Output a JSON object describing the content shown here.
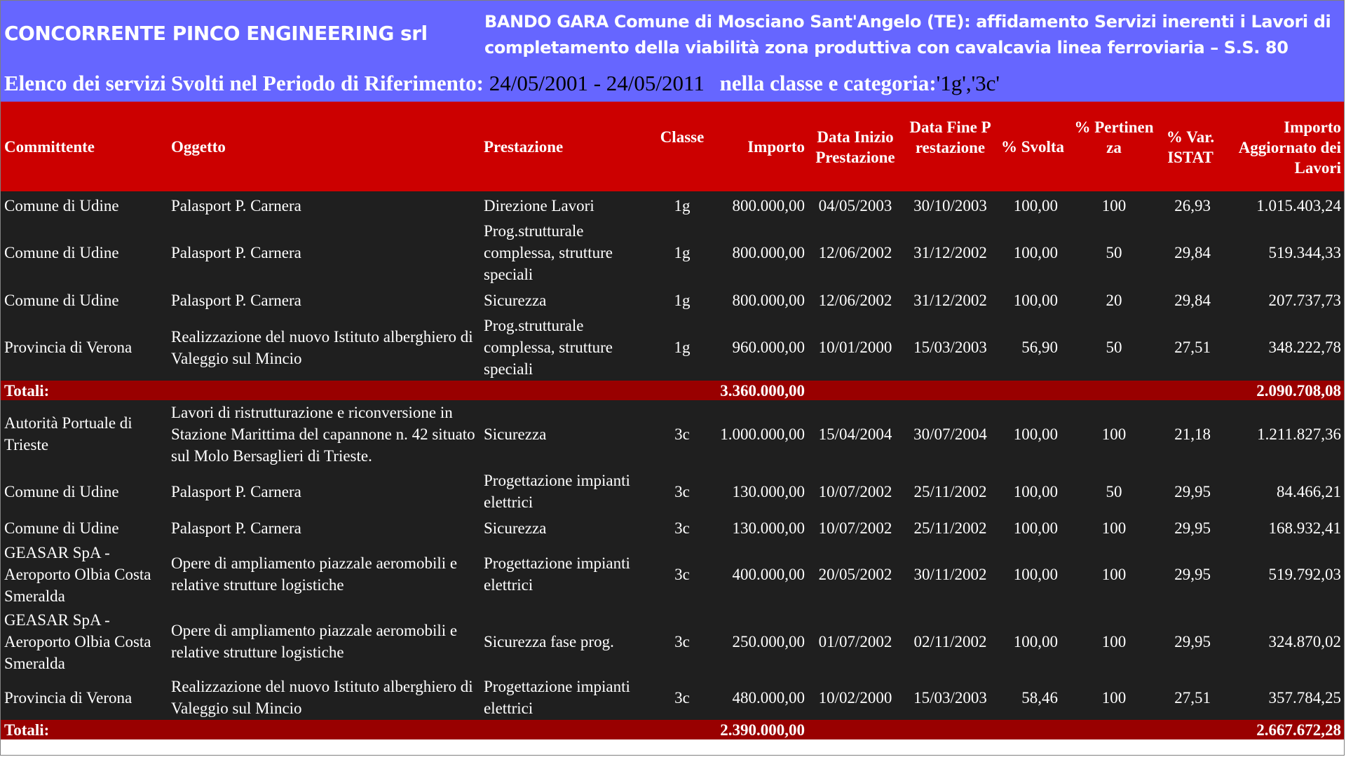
{
  "header": {
    "concorrente": "CONCORRENTE PINCO ENGINEERING srl",
    "bando": "BANDO GARA Comune di Mosciano Sant'Angelo (TE): affidamento Servizi inerenti i Lavori di completamento della viabilità zona produttiva con cavalcavia linea ferroviaria – S.S. 80",
    "elenco": "Elenco dei servizi",
    "svolti": "Svolti nel Periodo di Riferimento:",
    "period": "24/05/2001 - 24/05/2011",
    "classe_label": "nella classe e categoria:",
    "categoria": "'1g','3c'"
  },
  "columns": {
    "committente": "Committente",
    "oggetto": "Oggetto",
    "prestazione": "Prestazione",
    "classe": "Classe",
    "importo": "Importo",
    "data_inizio": "Data Inizio Prestazione",
    "data_fine": "Data Fine Prestazione",
    "svolta": "% Svolta",
    "pertinenza": "% Pertinenza",
    "var_istat": "% Var. ISTAT",
    "importo_agg": "Importo Aggiornato dei Lavori"
  },
  "rows": [
    {
      "type": "data",
      "committente": "Comune di Udine",
      "oggetto": "Palasport P. Carnera",
      "prestazione": "Direzione Lavori",
      "classe": "1g",
      "importo": "800.000,00",
      "inizio": "04/05/2003",
      "fine": "30/10/2003",
      "svolta": "100,00",
      "pertinenza": "100",
      "istat": "26,93",
      "agg": "1.015.403,24"
    },
    {
      "type": "data",
      "committente": "Comune di Udine",
      "oggetto": "Palasport P. Carnera",
      "prestazione": "Prog.strutturale complessa, strutture speciali",
      "classe": "1g",
      "importo": "800.000,00",
      "inizio": "12/06/2002",
      "fine": "31/12/2002",
      "svolta": "100,00",
      "pertinenza": "50",
      "istat": "29,84",
      "agg": "519.344,33"
    },
    {
      "type": "data",
      "committente": "Comune di Udine",
      "oggetto": "Palasport P. Carnera",
      "prestazione": "Sicurezza",
      "classe": "1g",
      "importo": "800.000,00",
      "inizio": "12/06/2002",
      "fine": "31/12/2002",
      "svolta": "100,00",
      "pertinenza": "20",
      "istat": "29,84",
      "agg": "207.737,73"
    },
    {
      "type": "data",
      "committente": "Provincia di Verona",
      "oggetto": "Realizzazione del nuovo Istituto alberghiero di Valeggio sul Mincio",
      "prestazione": "Prog.strutturale complessa, strutture speciali",
      "classe": "1g",
      "importo": "960.000,00",
      "inizio": "10/01/2000",
      "fine": "15/03/2003",
      "svolta": "56,90",
      "pertinenza": "50",
      "istat": "27,51",
      "agg": "348.222,78"
    },
    {
      "type": "total",
      "label": "Totali:",
      "importo": "3.360.000,00",
      "agg": "2.090.708,08"
    },
    {
      "type": "data",
      "committente": "Autorità Portuale di Trieste",
      "oggetto": "Lavori di ristrutturazione e riconversione in Stazione Marittima del capannone n. 42 situato sul Molo Bersaglieri di Trieste.",
      "prestazione": "Sicurezza",
      "classe": "3c",
      "importo": "1.000.000,00",
      "inizio": "15/04/2004",
      "fine": "30/07/2004",
      "svolta": "100,00",
      "pertinenza": "100",
      "istat": "21,18",
      "agg": "1.211.827,36"
    },
    {
      "type": "data",
      "committente": "Comune di Udine",
      "oggetto": "Palasport P. Carnera",
      "prestazione": "Progettazione impianti elettrici",
      "classe": "3c",
      "importo": "130.000,00",
      "inizio": "10/07/2002",
      "fine": "25/11/2002",
      "svolta": "100,00",
      "pertinenza": "50",
      "istat": "29,95",
      "agg": "84.466,21"
    },
    {
      "type": "data",
      "committente": "Comune di Udine",
      "oggetto": "Palasport P. Carnera",
      "prestazione": "Sicurezza",
      "classe": "3c",
      "importo": "130.000,00",
      "inizio": "10/07/2002",
      "fine": "25/11/2002",
      "svolta": "100,00",
      "pertinenza": "100",
      "istat": "29,95",
      "agg": "168.932,41"
    },
    {
      "type": "data",
      "committente": "GEASAR SpA -Aeroporto Olbia Costa Smeralda",
      "oggetto": "Opere di ampliamento piazzale aeromobili e relative strutture logistiche",
      "prestazione": "Progettazione impianti elettrici",
      "classe": "3c",
      "importo": "400.000,00",
      "inizio": "20/05/2002",
      "fine": "30/11/2002",
      "svolta": "100,00",
      "pertinenza": "100",
      "istat": "29,95",
      "agg": "519.792,03"
    },
    {
      "type": "data",
      "committente": "GEASAR SpA -Aeroporto Olbia Costa Smeralda",
      "oggetto": "Opere di ampliamento piazzale aeromobili e relative strutture logistiche",
      "prestazione": "Sicurezza fase prog.",
      "classe": "3c",
      "importo": "250.000,00",
      "inizio": "01/07/2002",
      "fine": "02/11/2002",
      "svolta": "100,00",
      "pertinenza": "100",
      "istat": "29,95",
      "agg": "324.870,02"
    },
    {
      "type": "data",
      "committente": "Provincia di Verona",
      "oggetto": "Realizzazione del nuovo Istituto alberghiero di Valeggio sul Mincio",
      "prestazione": "Progettazione impianti elettrici",
      "classe": "3c",
      "importo": "480.000,00",
      "inizio": "10/02/2000",
      "fine": "15/03/2003",
      "svolta": "58,46",
      "pertinenza": "100",
      "istat": "27,51",
      "agg": "357.784,25"
    },
    {
      "type": "total",
      "label": "Totali:",
      "importo": "2.390.000,00",
      "agg": "2.667.672,28"
    }
  ]
}
